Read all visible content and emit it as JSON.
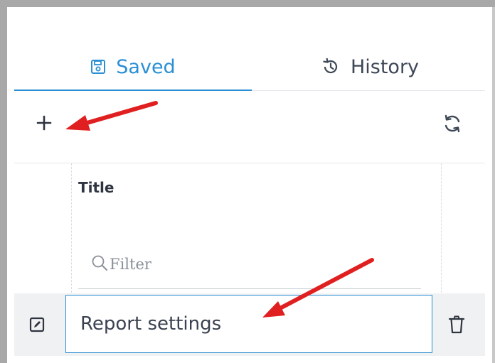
{
  "tabs": [
    {
      "label": "Saved",
      "icon": "floppy-disk-icon",
      "active": true,
      "color": "#2a8fd4"
    },
    {
      "label": "History",
      "icon": "history-icon",
      "active": false,
      "color": "#3d4756"
    }
  ],
  "toolbar": {
    "add_icon": "plus-icon",
    "refresh_icon": "refresh-icon"
  },
  "grid": {
    "column_title": "Title",
    "filter": {
      "placeholder": "Filter",
      "value": ""
    },
    "rows": [
      {
        "title": "Report settings",
        "selected": true
      }
    ]
  },
  "annotations": {
    "arrow_color": "#e02020"
  }
}
